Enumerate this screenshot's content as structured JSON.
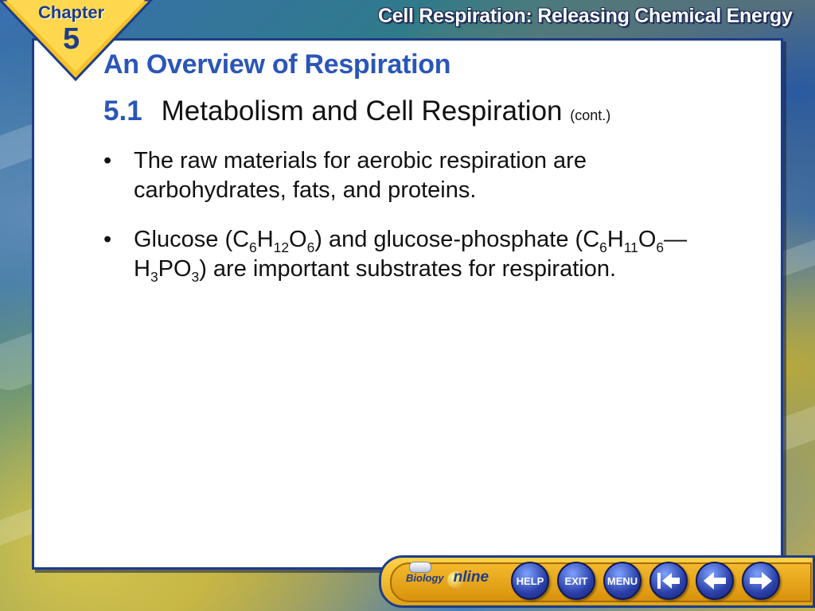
{
  "header": {
    "title": "Cell Respiration: Releasing Chemical Energy",
    "chapter_word": "Chapter",
    "chapter_number": "5"
  },
  "slide": {
    "title": "An Overview of Respiration",
    "section_number": "5.1",
    "section_title": "Metabolism and Cell Respiration",
    "section_suffix": "(cont.)",
    "bullet_glyph": "•",
    "bullets": [
      {
        "text": "The raw materials for aerobic respiration are carbohydrates, fats, and proteins."
      },
      {
        "parts": {
          "a": "Glucose (C",
          "b": "6",
          "c": "H",
          "d": "12",
          "e": "O",
          "f": "6",
          "g": ") and glucose-phosphate (C",
          "h": "6",
          "i": "H",
          "j": "11",
          "k": "O",
          "l": "6",
          "m": "—H",
          "n": "3",
          "o": "PO",
          "p": "3",
          "q": ") are important substrates for respiration."
        }
      }
    ]
  },
  "navbar": {
    "logo_small": "Biology",
    "logo_big": "nline",
    "buttons": [
      {
        "label": "HELP",
        "icon": "help-button"
      },
      {
        "label": "EXIT",
        "icon": "exit-button"
      },
      {
        "label": "MENU",
        "icon": "menu-button"
      },
      {
        "label": "",
        "icon": "first-slide-icon"
      },
      {
        "label": "",
        "icon": "previous-arrow-icon"
      },
      {
        "label": "",
        "icon": "next-arrow-icon"
      }
    ]
  },
  "colors": {
    "accent_blue": "#2a56b8",
    "frame_blue": "#1e3d86",
    "nav_gold": "#f4b92c"
  }
}
